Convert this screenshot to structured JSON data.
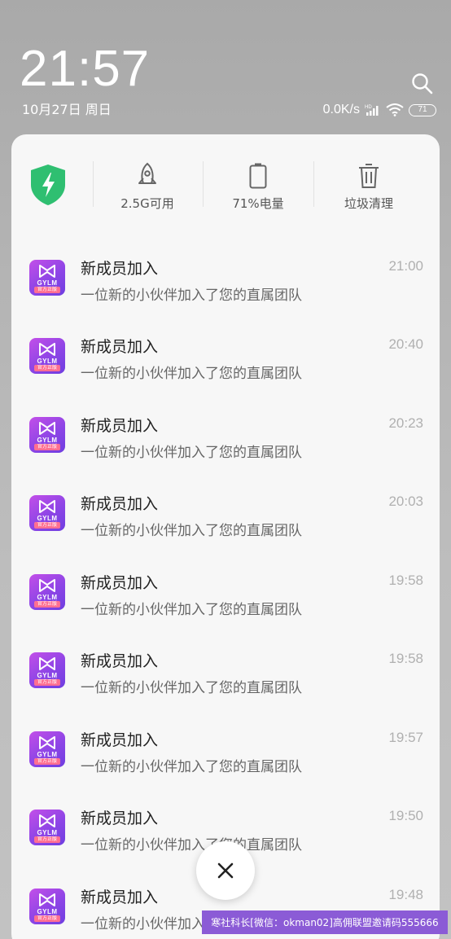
{
  "status": {
    "time": "21:57",
    "date": "10月27日 周日",
    "net_speed": "0.0K/s",
    "signal_label": "HD",
    "battery_pill": "71"
  },
  "quick": {
    "memory": "2.5G可用",
    "battery": "71%电量",
    "cleanup": "垃圾清理"
  },
  "app_icon": {
    "brand": "GYLM",
    "tag": "官方正版"
  },
  "notifications": [
    {
      "title": "新成员加入",
      "body": "一位新的小伙伴加入了您的直属团队",
      "time": "21:00"
    },
    {
      "title": "新成员加入",
      "body": "一位新的小伙伴加入了您的直属团队",
      "time": "20:40"
    },
    {
      "title": "新成员加入",
      "body": "一位新的小伙伴加入了您的直属团队",
      "time": "20:23"
    },
    {
      "title": "新成员加入",
      "body": "一位新的小伙伴加入了您的直属团队",
      "time": "20:03"
    },
    {
      "title": "新成员加入",
      "body": "一位新的小伙伴加入了您的直属团队",
      "time": "19:58"
    },
    {
      "title": "新成员加入",
      "body": "一位新的小伙伴加入了您的直属团队",
      "time": "19:58"
    },
    {
      "title": "新成员加入",
      "body": "一位新的小伙伴加入了您的直属团队",
      "time": "19:57"
    },
    {
      "title": "新成员加入",
      "body": "一位新的小伙伴加入了您的直属团队",
      "time": "19:50"
    },
    {
      "title": "新成员加入",
      "body": "一位新的小伙伴加入了您的直属团队",
      "time": "19:48"
    }
  ],
  "watermark": "寒社科长[微信：okman02]高佣联盟邀请码555666",
  "colors": {
    "shield": "#2fbf71",
    "app_icon_start": "#c34fe8",
    "app_icon_end": "#6f3ee0",
    "watermark_bg": "#8b5bd6"
  }
}
